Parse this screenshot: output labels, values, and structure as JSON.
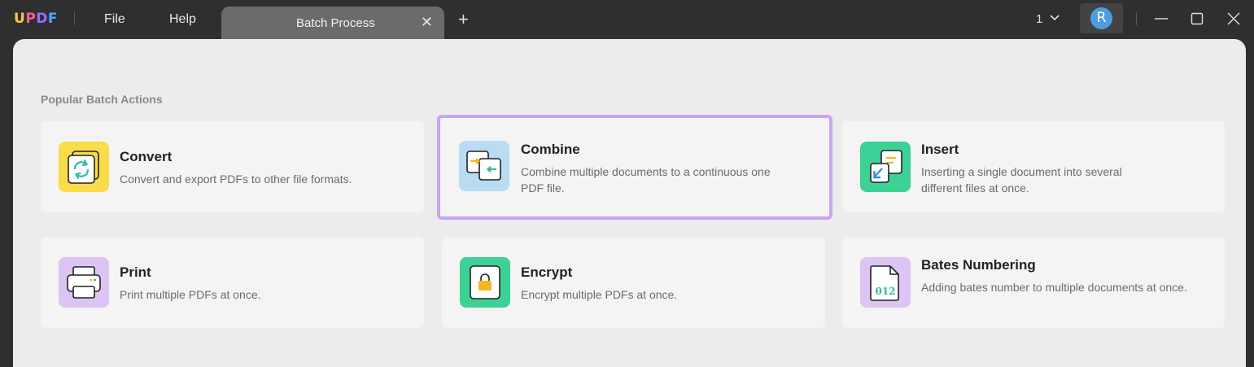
{
  "app": {
    "logo": [
      "U",
      "P",
      "D",
      "F"
    ],
    "menu": {
      "file": "File",
      "help": "Help"
    },
    "tab": {
      "label": "Batch Process",
      "close": "✕"
    },
    "new_tab": "+",
    "page_count": "1",
    "avatar_initial": "R"
  },
  "section_title": "Popular Batch Actions",
  "cards": [
    {
      "title": "Convert",
      "desc": "Convert and export PDFs to other file formats.",
      "icon": "convert-icon",
      "color": "#f9dc4a"
    },
    {
      "title": "Combine",
      "desc": "Combine multiple documents to a continuous one PDF file.",
      "icon": "combine-icon",
      "color": "#b9dcf4"
    },
    {
      "title": "Insert",
      "desc": "Inserting a single document into several different files at once.",
      "icon": "insert-icon",
      "color": "#3ed196"
    },
    {
      "title": "Print",
      "desc": "Print multiple PDFs at once.",
      "icon": "print-icon",
      "color": "#dcc4f4"
    },
    {
      "title": "Encrypt",
      "desc": "Encrypt multiple PDFs at once.",
      "icon": "encrypt-icon",
      "color": "#3ed196"
    },
    {
      "title": "Bates Numbering",
      "desc": "Adding bates number to multiple documents at once.",
      "icon": "bates-icon",
      "color": "#dcc4f4"
    }
  ],
  "bates_icon_digits": "012",
  "selected_card": "Combine"
}
